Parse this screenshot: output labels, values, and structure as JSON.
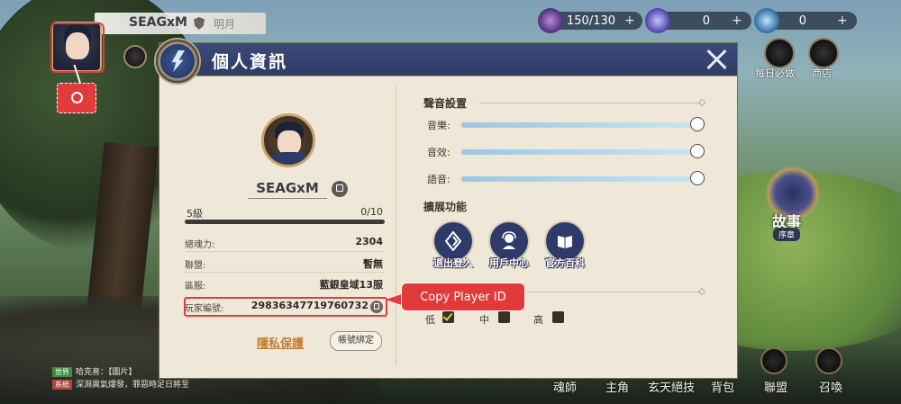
{
  "hud": {
    "player_name": "SEAGxM",
    "server_short": "明月",
    "resources": [
      {
        "value": "150/130",
        "icon": "stamina-icon",
        "color": "#6a4fa0"
      },
      {
        "value": "0",
        "icon": "crystal-icon",
        "color": "#7a6cd0"
      },
      {
        "value": "0",
        "icon": "fish-icon",
        "color": "#5aa7d8"
      }
    ],
    "shortcuts": [
      {
        "label": "每日必做",
        "icon": "daily-icon"
      },
      {
        "label": "商店",
        "icon": "shop-icon"
      }
    ],
    "story_label": "故事",
    "story_sub": "序章",
    "bottom_nav": [
      "魂師",
      "主角",
      "玄天絕技",
      "背包",
      "聯盟",
      "召喚"
    ],
    "chat": [
      {
        "tag": "世界",
        "text": "哈克喜：【圖片】",
        "tag_color": "#3e8c3e"
      },
      {
        "tag": "系統",
        "text": "深淵異氣爆發，罪惡時足日將至",
        "tag_color": "#b5433b"
      }
    ]
  },
  "panel": {
    "title": "個人資訊",
    "player": {
      "name": "SEAGxM",
      "level_label": "5級",
      "xp_text": "0/10",
      "xp_fraction": 0.0
    },
    "stats": [
      {
        "key": "總魂力:",
        "value": "2304"
      },
      {
        "key": "聯盟:",
        "value": "暫無"
      },
      {
        "key": "區服:",
        "value": "藍銀皇域13服"
      },
      {
        "key": "玩家編號:",
        "value": "29836347719760732"
      }
    ],
    "privacy_link": "隱私保護",
    "bind_button": "帳號綁定",
    "sound": {
      "title": "聲音設置",
      "items": [
        {
          "label": "音樂:",
          "level": 1.0
        },
        {
          "label": "音效:",
          "level": 1.0
        },
        {
          "label": "語音:",
          "level": 1.0
        }
      ]
    },
    "extensions": {
      "title": "擴展功能",
      "items": [
        {
          "label": "退出登入",
          "icon": "logout-icon"
        },
        {
          "label": "用戶中心",
          "icon": "user-center-icon"
        },
        {
          "label": "官方百科",
          "icon": "wiki-book-icon"
        }
      ]
    },
    "quality": {
      "options": [
        {
          "label": "低",
          "checked": true
        },
        {
          "label": "中",
          "checked": false
        },
        {
          "label": "高",
          "checked": false
        }
      ]
    }
  },
  "annotation": {
    "tooltip": "Copy Player ID",
    "accent": "#e23b3b"
  }
}
